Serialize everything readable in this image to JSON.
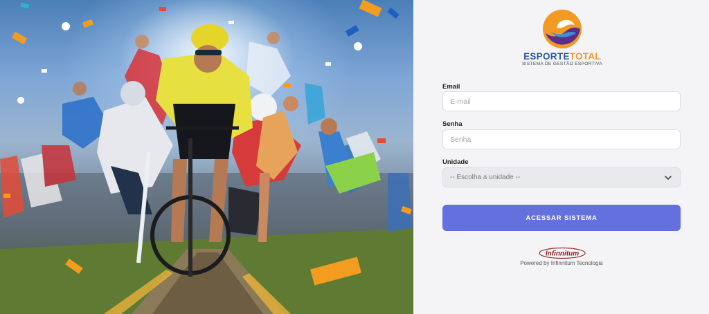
{
  "hero": {
    "colors": {
      "confetti": [
        "#f39c1f",
        "#1f5fc4",
        "#e84a2a",
        "#ffffff",
        "#2cb3c7"
      ]
    }
  },
  "brand": {
    "name_part1": "ESPORTE",
    "name_part2": "TOTAL",
    "tagline": "SISTEMA DE GESTÃO ESPORTIVA",
    "colors": {
      "blue": "#2a5aa6",
      "orange": "#f29a24",
      "purple": "#5b2e8c"
    }
  },
  "form": {
    "email": {
      "label": "Email",
      "placeholder": "E-mail",
      "value": ""
    },
    "password": {
      "label": "Senha",
      "placeholder": "Senha",
      "value": ""
    },
    "unit": {
      "label": "Unidade",
      "selected": "-- Escolha a unidade --"
    },
    "submit_label": "ACESSAR SISTEMA"
  },
  "footer": {
    "logo_text": "Infinnitum",
    "powered_by": "Powered by Infinnitum Tecnologia"
  },
  "colors": {
    "accent": "#6470dd",
    "panel_bg": "#f4f4f6"
  }
}
